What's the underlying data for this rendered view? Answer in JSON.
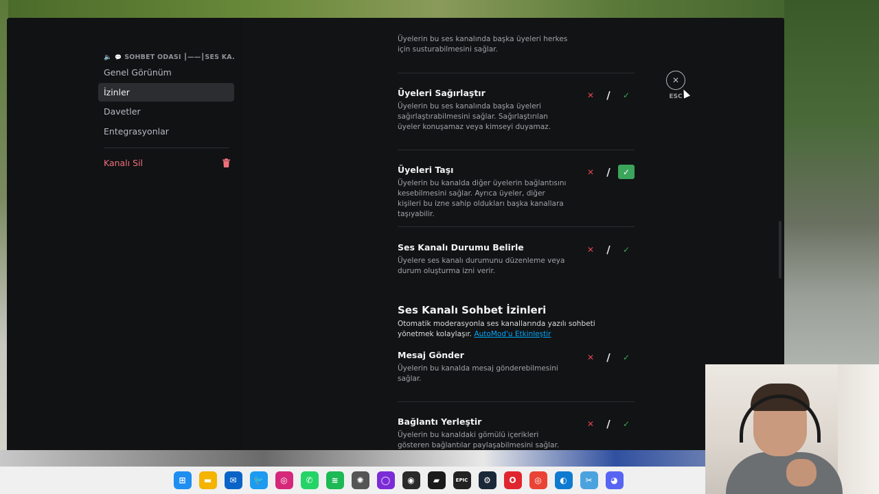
{
  "window": {
    "controls": {
      "minimize": "—",
      "maximize": "☐",
      "close": "✕"
    }
  },
  "sidebar": {
    "header": "SOHBET ODASI ┃——┃SES KA...",
    "items": [
      {
        "label": "Genel Görünüm",
        "active": false
      },
      {
        "label": "İzinler",
        "active": true
      },
      {
        "label": "Davetler",
        "active": false
      },
      {
        "label": "Entegrasyonlar",
        "active": false
      }
    ],
    "delete_label": "Kanalı Sil",
    "danger_color": "#f0707a"
  },
  "permissions": [
    {
      "title": "",
      "desc": "Üyelerin bu ses kanalında başka üyeleri herkes için susturabilmesini sağlar.",
      "state": "none"
    },
    {
      "title": "Üyeleri Sağırlaştır",
      "desc": "Üyelerin bu ses kanalında başka üyeleri sağırlaştırabilmesini sağlar. Sağırlaştırılan üyeler konuşamaz veya kimseyi duyamaz.",
      "state": "neutral"
    },
    {
      "title": "Üyeleri Taşı",
      "desc": "Üyelerin bu kanalda diğer üyelerin bağlantısını kesebilmesini sağlar. Ayrıca üyeler, diğer kişileri bu izne sahip oldukları başka kanallara taşıyabilir.",
      "state": "allow"
    },
    {
      "title": "Ses Kanalı Durumu Belirle",
      "desc": "Üyelere ses kanalı durumunu düzenleme veya durum oluşturma izni verir.",
      "state": "neutral"
    },
    {
      "title": "Mesaj Gönder",
      "desc": "Üyelerin bu kanalda mesaj gönderebilmesini sağlar.",
      "state": "neutral"
    },
    {
      "title": "Bağlantı Yerleştir",
      "desc": "Üyelerin bu kanaldaki gömülü içerikleri gösteren bağlantılar paylaşabilmesini sağlar.",
      "state": "neutral"
    }
  ],
  "tristate": {
    "deny": "✕",
    "neutral": "/",
    "allow": "✓"
  },
  "section": {
    "title": "Ses Kanalı Sohbet İzinleri",
    "desc": "Otomatik moderasyonla ses kanallarında yazılı sohbeti yönetmek kolaylaşır.",
    "link": "AutoMod'u Etkinleştir"
  },
  "close": {
    "icon": "✕",
    "label": "ESC"
  },
  "taskbar": {
    "icons": [
      {
        "name": "windows-start-icon",
        "glyph": "⊞",
        "color": "#1f8ef1"
      },
      {
        "name": "file-explorer-icon",
        "glyph": "▬",
        "color": "#f4b400"
      },
      {
        "name": "outlook-icon",
        "glyph": "✉",
        "color": "#0a64c8"
      },
      {
        "name": "twitter-icon",
        "glyph": "🐦",
        "color": "#1d9bf0"
      },
      {
        "name": "instagram-icon",
        "glyph": "◎",
        "color": "#d6287a"
      },
      {
        "name": "whatsapp-icon",
        "glyph": "✆",
        "color": "#25d366"
      },
      {
        "name": "spotify-icon",
        "glyph": "≋",
        "color": "#1db954"
      },
      {
        "name": "chatgpt-icon",
        "glyph": "✺",
        "color": "#555555"
      },
      {
        "name": "purple-app-icon",
        "glyph": "◯",
        "color": "#7b2cd6"
      },
      {
        "name": "obs-icon",
        "glyph": "◉",
        "color": "#2a2a2a"
      },
      {
        "name": "gamesir-icon",
        "glyph": "▰",
        "color": "#1a1a1a"
      },
      {
        "name": "epic-games-icon",
        "glyph": "EPIC",
        "color": "#222222"
      },
      {
        "name": "steam-icon",
        "glyph": "⚙",
        "color": "#1b2838"
      },
      {
        "name": "opera-icon",
        "glyph": "O",
        "color": "#e0252f"
      },
      {
        "name": "chrome-icon",
        "glyph": "◎",
        "color": "#ea4335"
      },
      {
        "name": "edge-icon",
        "glyph": "◐",
        "color": "#0f7bd0"
      },
      {
        "name": "snipping-tool-icon",
        "glyph": "✂",
        "color": "#4aa3df"
      },
      {
        "name": "discord-icon",
        "glyph": "◕",
        "color": "#5865f2"
      }
    ]
  }
}
